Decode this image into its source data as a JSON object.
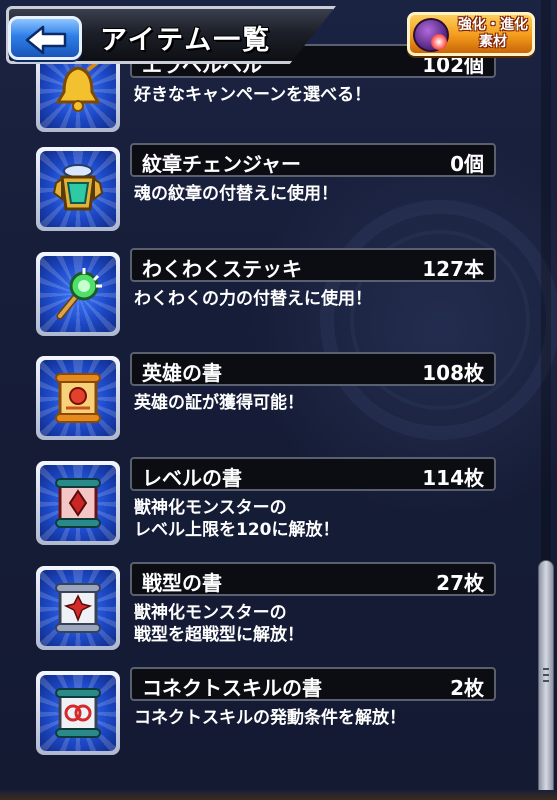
{
  "header": {
    "title": "アイテム一覧",
    "back_icon": "left-arrow-icon",
    "material_button_label_line1": "強化・進化",
    "material_button_label_line2": "素材",
    "material_icon": "material-orb-icon"
  },
  "items": [
    {
      "name": "エラベルベル",
      "count": "102個",
      "desc_line1": "好きなキャンペーンを選べる！",
      "desc_line2": "",
      "icon": "bell-icon"
    },
    {
      "name": "紋章チェンジャー",
      "count": "0個",
      "desc_line1": "魂の紋章の付替えに使用！",
      "desc_line2": "",
      "icon": "emblem-changer-icon"
    },
    {
      "name": "わくわくステッキ",
      "count": "127本",
      "desc_line1": "わくわくの力の付替えに使用！",
      "desc_line2": "",
      "icon": "wand-icon"
    },
    {
      "name": "英雄の書",
      "count": "108枚",
      "desc_line1": "英雄の証が獲得可能！",
      "desc_line2": "",
      "icon": "hero-scroll-icon"
    },
    {
      "name": "レベルの書",
      "count": "114枚",
      "desc_line1": "獣神化モンスターの",
      "desc_line2": "レベル上限を120に解放！",
      "icon": "level-scroll-icon"
    },
    {
      "name": "戦型の書",
      "count": "27枚",
      "desc_line1": "獣神化モンスターの",
      "desc_line2": "戦型を超戦型に解放！",
      "icon": "battle-type-scroll-icon"
    },
    {
      "name": "コネクトスキルの書",
      "count": "2枚",
      "desc_line1": "コネクトスキルの発動条件を解放！",
      "desc_line2": "",
      "icon": "connect-skill-scroll-icon"
    }
  ],
  "colors": {
    "background": "#151b33",
    "accent_blue": "#2e7ee8",
    "material_orange": "#f29a1b"
  }
}
